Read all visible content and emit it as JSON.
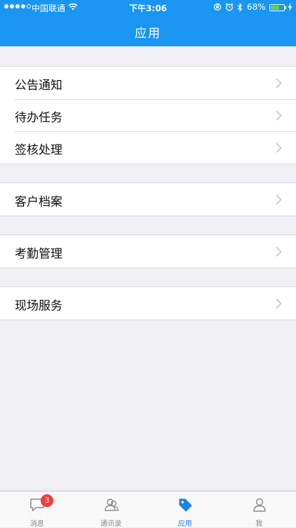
{
  "status_bar": {
    "carrier": "中国联通",
    "time": "下午3:06",
    "battery_percent": "68%",
    "battery_level": 0.68,
    "signal_bars": 4
  },
  "header": {
    "title": "应用"
  },
  "groups": [
    {
      "items": [
        {
          "label": "公告通知"
        },
        {
          "label": "待办任务"
        },
        {
          "label": "签核处理"
        }
      ]
    },
    {
      "items": [
        {
          "label": "客户档案"
        }
      ]
    },
    {
      "items": [
        {
          "label": "考勤管理"
        }
      ]
    },
    {
      "items": [
        {
          "label": "现场服务"
        }
      ]
    }
  ],
  "tabbar": {
    "tabs": [
      {
        "label": "消息",
        "icon": "chat-bubble-icon",
        "badge": "3"
      },
      {
        "label": "通讯录",
        "icon": "contacts-icon"
      },
      {
        "label": "应用",
        "icon": "tag-icon",
        "active": true
      },
      {
        "label": "我",
        "icon": "person-icon"
      }
    ]
  },
  "colors": {
    "header": "#1a96f2",
    "background": "#efeff4",
    "active_tab": "#1a84e8",
    "badge": "#f23c3c"
  }
}
